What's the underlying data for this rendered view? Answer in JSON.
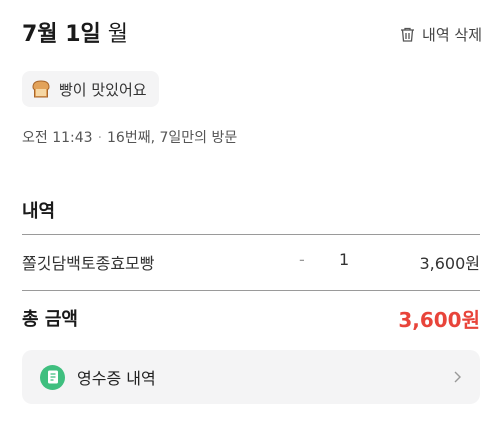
{
  "header": {
    "date_strong": "7월 1일",
    "weekday": "월",
    "delete_label": "내역 삭제"
  },
  "review_chip": {
    "icon": "bread-icon",
    "label": "빵이 맛있어요"
  },
  "visit": {
    "time": "오전 11:43",
    "separator": "·",
    "info": "16번째, 7일만의 방문"
  },
  "details": {
    "title": "내역",
    "items": [
      {
        "name": "쫄깃담백토종효모빵",
        "dash": "-",
        "qty": "1",
        "price": "3,600원"
      }
    ]
  },
  "total": {
    "label": "총 금액",
    "amount": "3,600원"
  },
  "receipt": {
    "icon": "receipt-icon",
    "label": "영수증 내역"
  },
  "colors": {
    "accent_red": "#e8443a",
    "receipt_green": "#3fbf7f",
    "chip_bg": "#f4f4f5"
  }
}
